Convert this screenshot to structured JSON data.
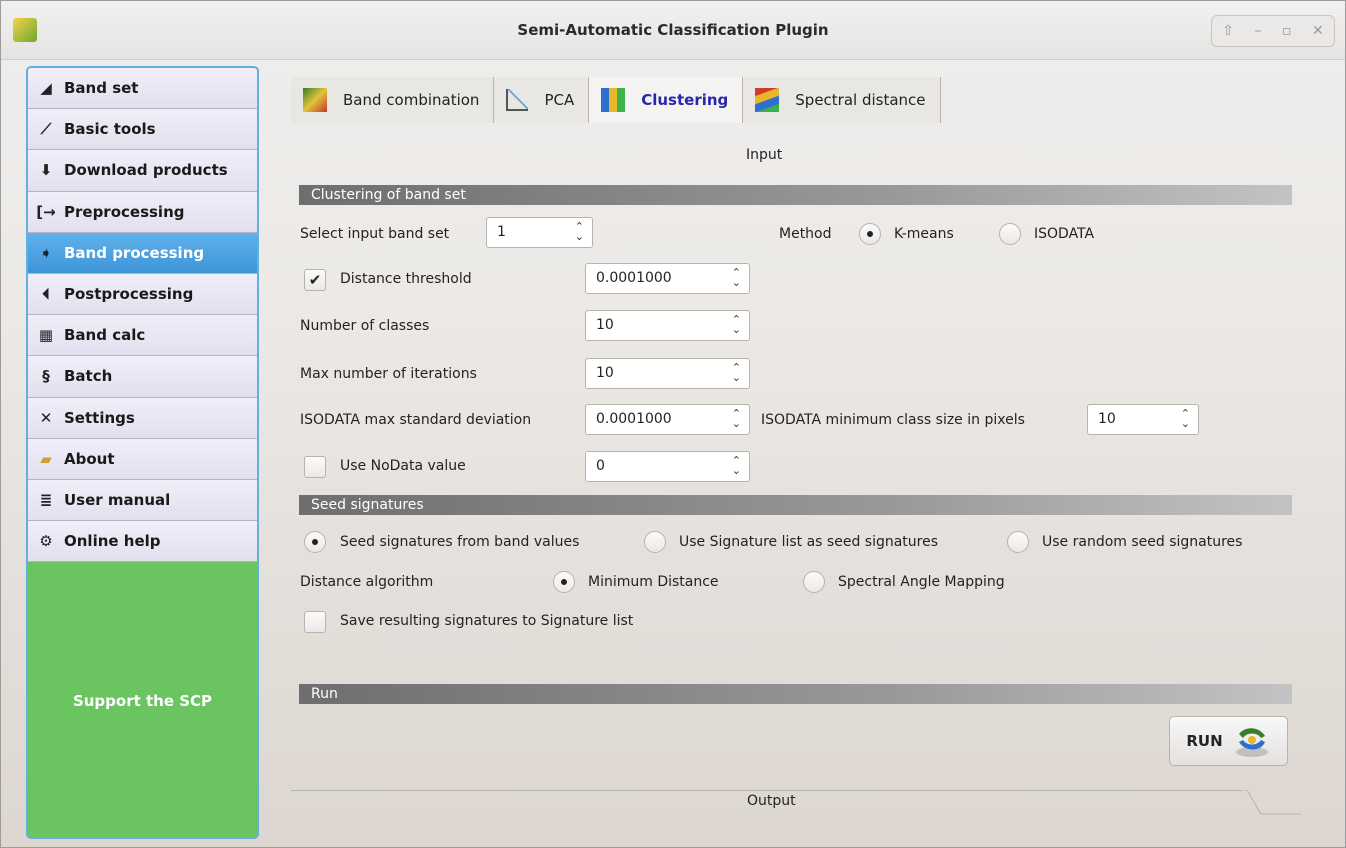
{
  "window": {
    "title": "Semi-Automatic Classification Plugin"
  },
  "sidebar": {
    "items": [
      {
        "label": "Band set",
        "icon": "band-set-icon"
      },
      {
        "label": "Basic tools",
        "icon": "basic-tools-icon"
      },
      {
        "label": "Download products",
        "icon": "download-icon"
      },
      {
        "label": "Preprocessing",
        "icon": "preprocessing-icon"
      },
      {
        "label": "Band processing",
        "icon": "band-processing-icon"
      },
      {
        "label": "Postprocessing",
        "icon": "postprocessing-icon"
      },
      {
        "label": "Band calc",
        "icon": "band-calc-icon"
      },
      {
        "label": "Batch",
        "icon": "batch-icon"
      },
      {
        "label": "Settings",
        "icon": "settings-icon"
      },
      {
        "label": "About",
        "icon": "about-icon"
      },
      {
        "label": "User manual",
        "icon": "user-manual-icon"
      },
      {
        "label": "Online help",
        "icon": "online-help-icon"
      }
    ],
    "active": "Band processing",
    "support_label": "Support the SCP"
  },
  "tabs": [
    {
      "label": "Band combination"
    },
    {
      "label": "PCA"
    },
    {
      "label": "Clustering"
    },
    {
      "label": "Spectral distance"
    }
  ],
  "input_label": "Input",
  "clustering": {
    "section_title": "Clustering of band set",
    "select_band_set_label": "Select input band set",
    "band_set_value": "1",
    "method_label": "Method",
    "method_kmeans": "K-means",
    "method_isodata": "ISODATA",
    "method_selected": "K-means",
    "distance_threshold_label": "Distance threshold",
    "distance_threshold_checked": true,
    "distance_threshold_value": "0.0001000",
    "num_classes_label": "Number of classes",
    "num_classes_value": "10",
    "max_iter_label": "Max number of iterations",
    "max_iter_value": "10",
    "isodata_std_label": "ISODATA max standard deviation",
    "isodata_std_value": "0.0001000",
    "isodata_min_size_label": "ISODATA minimum class size in pixels",
    "isodata_min_size_value": "10",
    "nodata_label": "Use NoData value",
    "nodata_checked": false,
    "nodata_value": "0"
  },
  "seed": {
    "section_title": "Seed signatures",
    "opt_band_values": "Seed signatures from band values",
    "opt_signature_list": "Use Signature list as seed signatures",
    "opt_random": "Use random seed signatures",
    "selected": "Seed signatures from band values",
    "distance_algorithm_label": "Distance algorithm",
    "algo_min_distance": "Minimum Distance",
    "algo_sam": "Spectral Angle Mapping",
    "algo_selected": "Minimum Distance",
    "save_signatures_label": "Save resulting signatures to Signature list",
    "save_signatures_checked": false
  },
  "run": {
    "section_title": "Run",
    "button_label": "RUN"
  },
  "output_label": "Output"
}
